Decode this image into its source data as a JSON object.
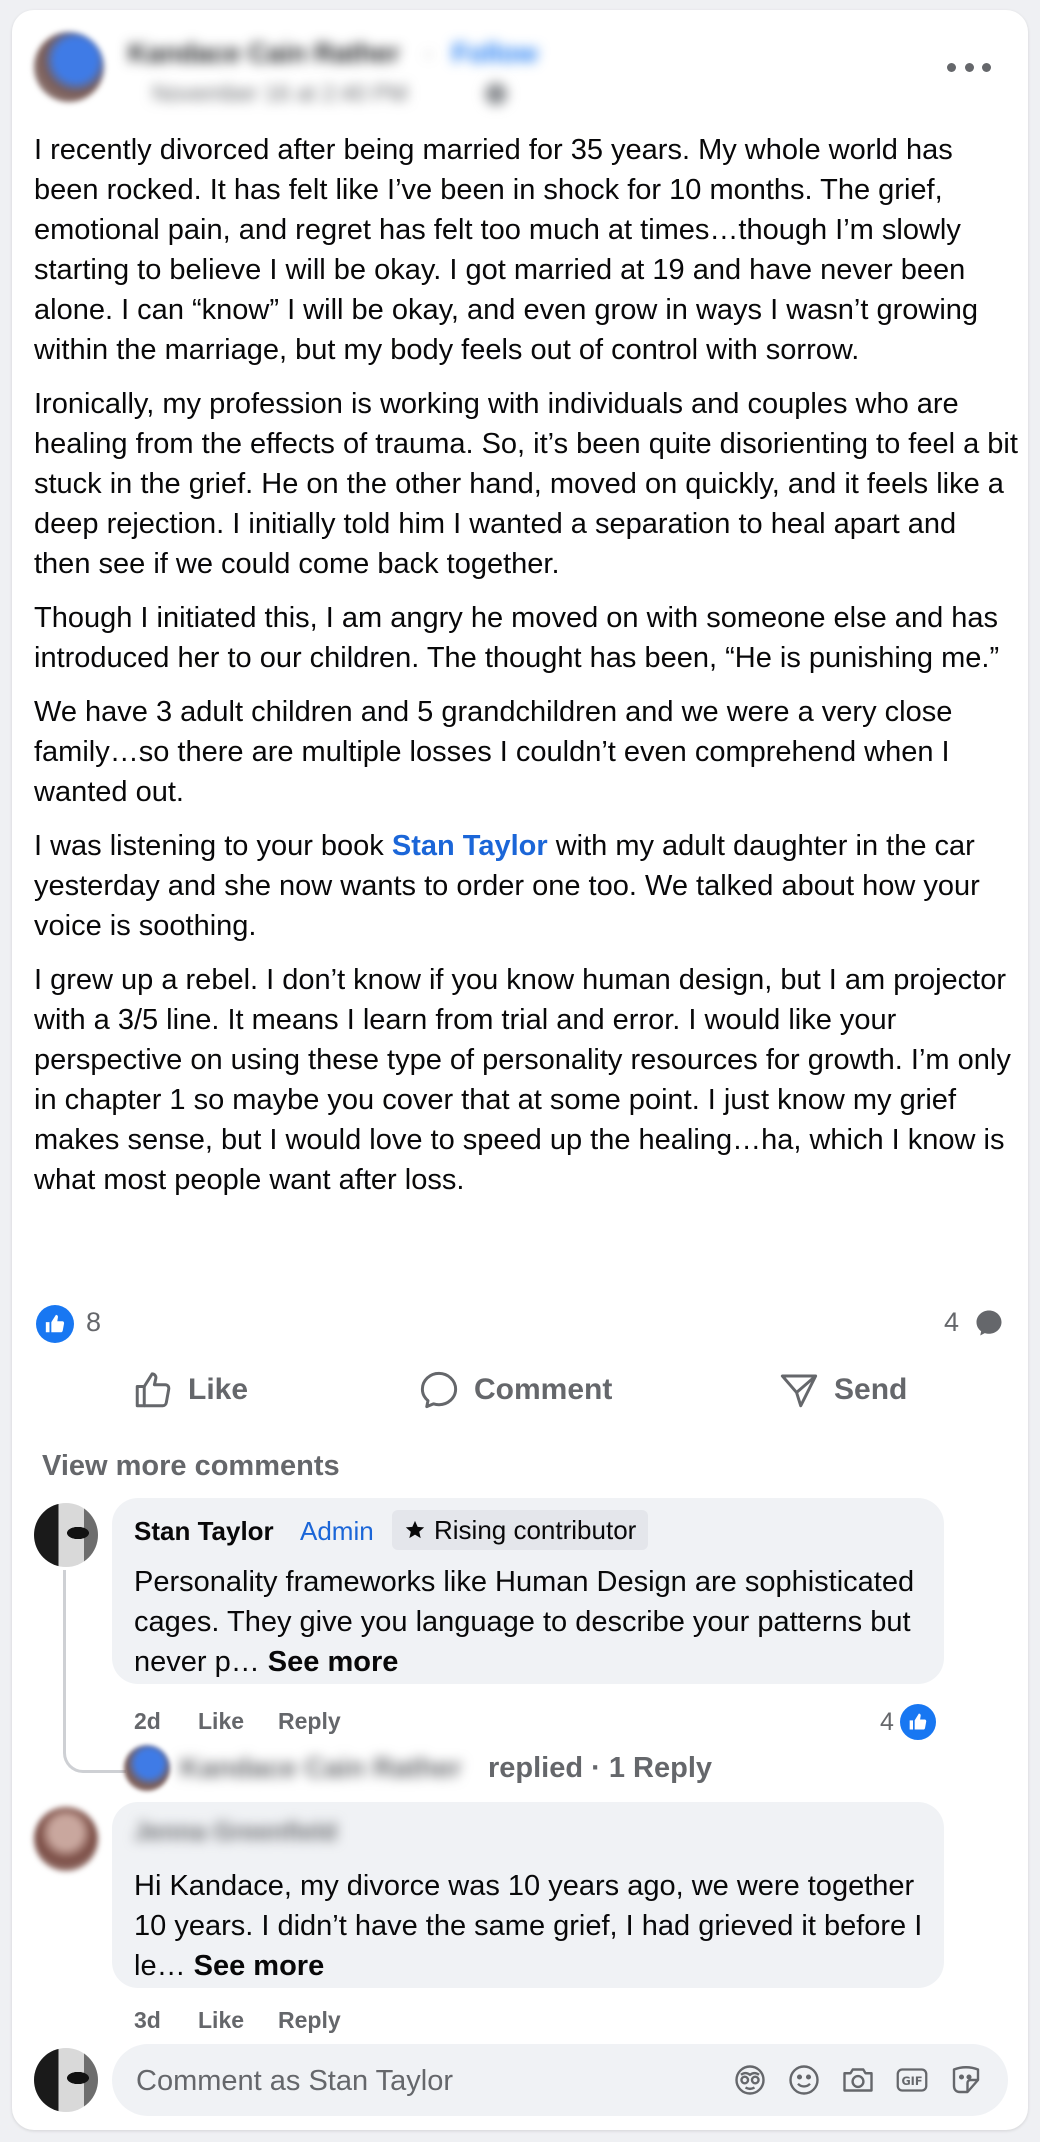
{
  "post": {
    "author": "Kandace Cain Rather",
    "follow_label": "Follow",
    "separator": "·",
    "date": "November 16 at 2:40 PM",
    "paragraphs": [
      "I recently divorced after being married for 35 years. My whole world has been rocked. It has felt like I’ve been in shock for 10 months. The grief, emotional pain, and regret has felt too much at times…though I’m slowly starting to believe I will be okay. I got married at 19 and have never been alone. I can “know” I will be okay, and even grow in ways I wasn’t growing within the marriage, but my body feels out of control with sorrow.",
      "Ironically, my profession is working with individuals and couples who are healing from the effects of trauma. So, it’s been quite disorienting to feel a bit stuck in the grief. He on the other hand, moved on quickly, and it feels like a deep rejection. I initially told him I wanted a separation to heal apart and then see if we could come back together.",
      "Though I initiated this, I am angry he moved on with someone else and has introduced her to our children. The thought has been, “He is punishing me.”",
      "We have 3 adult children and 5 grandchildren and we were a very close family…so there are multiple losses I couldn’t even comprehend when I wanted out."
    ],
    "para5": {
      "before": "I was listening to your book ",
      "mention": "Stan Taylor",
      "after": " with my adult daughter in the car yesterday and she now wants to order one too. We talked about how your voice is soothing."
    },
    "paragraph6": "I grew up a rebel. I don’t know if you know human design, but I am projector with a 3/5 line. It means I learn from trial and error. I would like your perspective on using these type of personality resources for growth. I’m only in chapter 1 so maybe you cover that at some point. I just know my grief makes sense, but I would love to speed up the healing…ha, which I know is what most people want after loss.",
    "reaction_count": "8",
    "comment_count": "4"
  },
  "actions": {
    "like": "Like",
    "comment": "Comment",
    "send": "Send"
  },
  "comments": {
    "view_more": "View more comments",
    "first": {
      "author": "Stan Taylor",
      "role": "Admin",
      "badge": "Rising contributor",
      "text": "Personality frameworks like Human Design are sophisticated cages. They give you language to describe your patterns but never p…",
      "see_more": "See more",
      "time": "2d",
      "like": "Like",
      "reply": "Reply",
      "reactions": "4",
      "reply_author": "Kandace Cain Rather",
      "replied_text": "replied · 1 Reply"
    },
    "second": {
      "author": "Jenna Greenfield",
      "text": "Hi Kandace, my divorce was 10 years ago, we were together 10 years. I didn’t have the same grief, I had grieved it before I le…",
      "see_more": "See more",
      "time": "3d",
      "like": "Like",
      "reply": "Reply"
    }
  },
  "composer": {
    "placeholder": "Comment as Stan Taylor",
    "icons": [
      "avatar-sticker-icon",
      "emoji-icon",
      "camera-icon",
      "gif-icon",
      "sticker-icon"
    ]
  },
  "colors": {
    "accent": "#1877f2",
    "link": "#1b66d8",
    "muted": "#65676b",
    "bubble": "#f0f2f5"
  }
}
